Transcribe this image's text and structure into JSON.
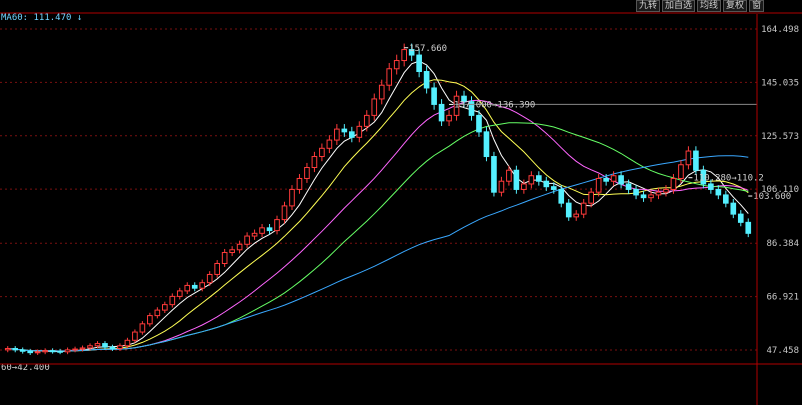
{
  "toolbar": {
    "buttons": [
      "九转",
      "加自选",
      "均线",
      "复权",
      "窗"
    ]
  },
  "ma_label": "MA60: 111.470 ↓",
  "colors": {
    "up": "#ff3b3b",
    "down": "#55f0ff",
    "grid": "#7a1010",
    "axis": "#b00000",
    "ma5": "#ffffff",
    "ma10": "#ffff55",
    "ma20": "#ff66ff",
    "ma30": "#66ff66",
    "ma60": "#3aa8ff"
  },
  "chart_data": {
    "type": "candlestick",
    "y_ticks": [
      "164.498",
      "145.035",
      "125.573",
      "106.110",
      "86.384",
      "66.921",
      "47.458"
    ],
    "ylim": [
      47.458,
      164.498
    ],
    "annotations": [
      {
        "text": "157.660",
        "price": 157.66
      },
      {
        "text": "137.000→136.390",
        "price": 137.0
      },
      {
        "text": "110.280→110.2",
        "price": 110.28
      },
      {
        "text": "103.600",
        "price": 103.6
      },
      {
        "text": "60→42.400",
        "price": 42.4
      }
    ],
    "closes": [
      48,
      47.5,
      47,
      46.5,
      46.8,
      47.2,
      47,
      46.8,
      47.5,
      47.8,
      48.2,
      49,
      49.8,
      48.5,
      48,
      49,
      51,
      54,
      57,
      60,
      62,
      64,
      67,
      69,
      71,
      70,
      72,
      75,
      79,
      83,
      84,
      86,
      89,
      90,
      92,
      91,
      95,
      100,
      106,
      110,
      114,
      118,
      121,
      124,
      128,
      127,
      125,
      129,
      133,
      139,
      144,
      150,
      153,
      157,
      155,
      149,
      143,
      137,
      131,
      133,
      140,
      138,
      133,
      127,
      118,
      105,
      109,
      113,
      106,
      108,
      111,
      109,
      107,
      106,
      101,
      96,
      97,
      101,
      105,
      110,
      109,
      111,
      108,
      106,
      104,
      103,
      104,
      105,
      106,
      110,
      115,
      120,
      113,
      108,
      106,
      104,
      101,
      97,
      94,
      90
    ]
  }
}
